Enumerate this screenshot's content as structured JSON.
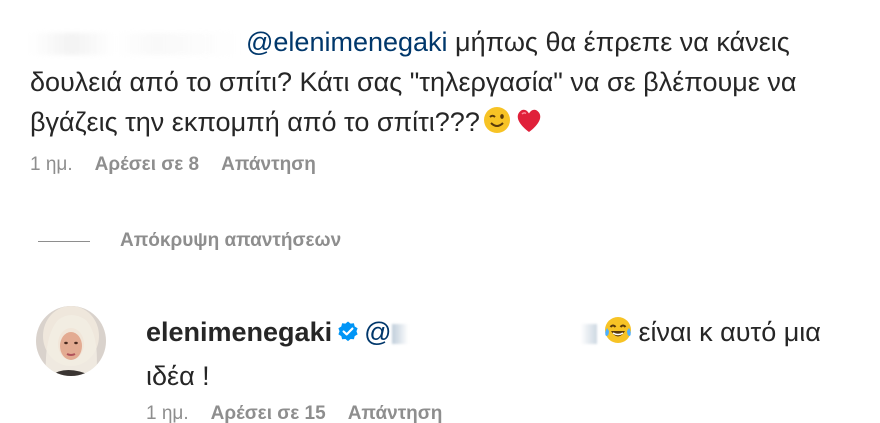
{
  "comment": {
    "mention": "@elenimenegaki",
    "text": " μήπως θα έπρεπε να κάνεις δουλειά από το σπίτι? Κάτι σας \"τηλεργασία\" να σε βλέπουμε να βγάζεις την εκπομπή από το σπίτι???",
    "emojis": [
      "wink-emoji",
      "heart-emoji"
    ],
    "meta": {
      "time": "1 ημ.",
      "likes": "Αρέσει σε 8",
      "reply": "Απάντηση"
    }
  },
  "hide_replies_label": "Απόκρυψη απαντήσεων",
  "reply": {
    "username": "elenimenegaki",
    "mention_prefix": "@",
    "text": "είναι κ αυτό μια ιδέα !",
    "emoji": "tears-of-joy-emoji",
    "meta": {
      "time": "1 ημ.",
      "likes": "Αρέσει σε 15",
      "reply": "Απάντηση"
    }
  },
  "colors": {
    "text": "#262626",
    "secondary": "#8e8e8e",
    "mention": "#00376b",
    "verified": "#0095f6"
  }
}
